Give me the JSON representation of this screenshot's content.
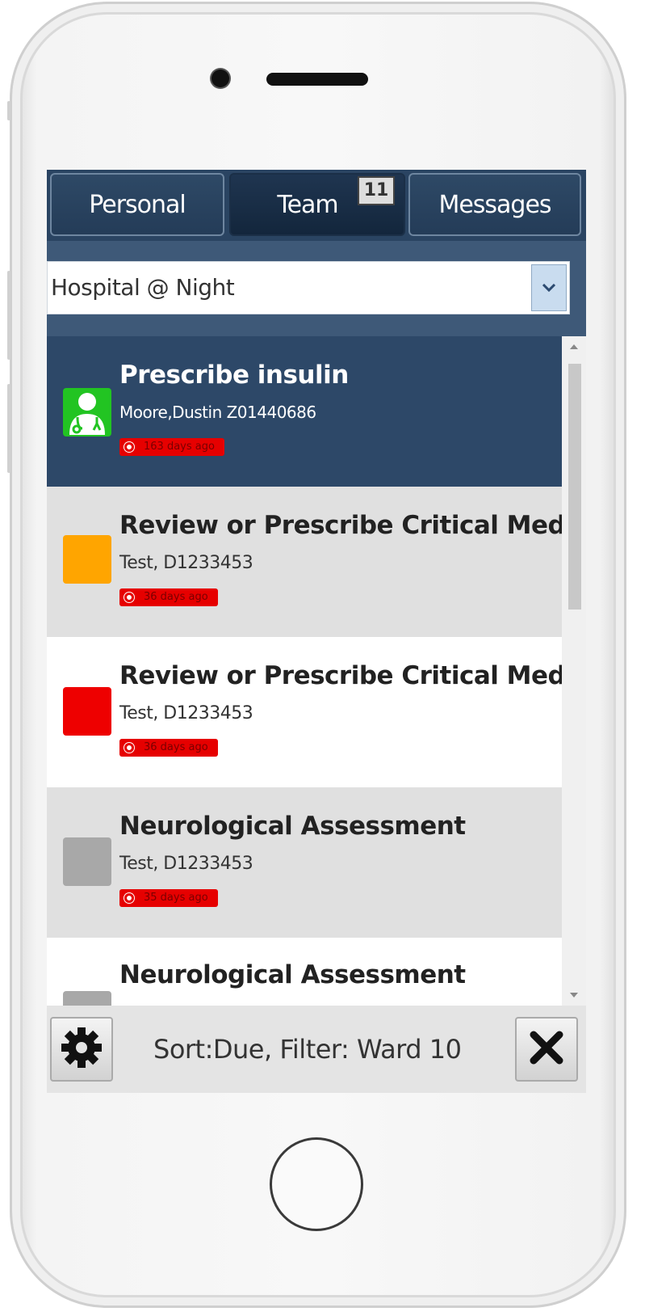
{
  "tabs": [
    {
      "label": "Personal"
    },
    {
      "label": "Team",
      "badge": "11"
    },
    {
      "label": "Messages"
    }
  ],
  "location_select": {
    "value": "Hospital @ Night"
  },
  "tasks": [
    {
      "title": "Prescribe insulin",
      "patient": "Moore,Dustin Z01440686",
      "due": "163 days ago",
      "priority_color": "#22c422",
      "icon": "doctor-icon",
      "selected": true
    },
    {
      "title": "Review or Prescribe Critical Meds (",
      "patient": "Test, D1233453",
      "due": "36 days ago",
      "priority_color": "#ffa500"
    },
    {
      "title": "Review or Prescribe Critical Meds (",
      "patient": "Test, D1233453",
      "due": "36 days ago",
      "priority_color": "#ee0000"
    },
    {
      "title": "Neurological Assessment",
      "patient": "Test, D1233453",
      "due": "35 days ago",
      "priority_color": "#a8a8a8"
    },
    {
      "title": "Neurological Assessment",
      "patient": "",
      "due": "",
      "priority_color": "#a8a8a8"
    }
  ],
  "footer": {
    "status": "Sort:Due, Filter: Ward 10",
    "settings_icon": "gear-icon",
    "close_icon": "close-icon"
  },
  "colors": {
    "header": "#2a4462",
    "selected_row": "#2d4868",
    "alt_row": "#e0e0e0",
    "due_badge": "#e60000"
  }
}
